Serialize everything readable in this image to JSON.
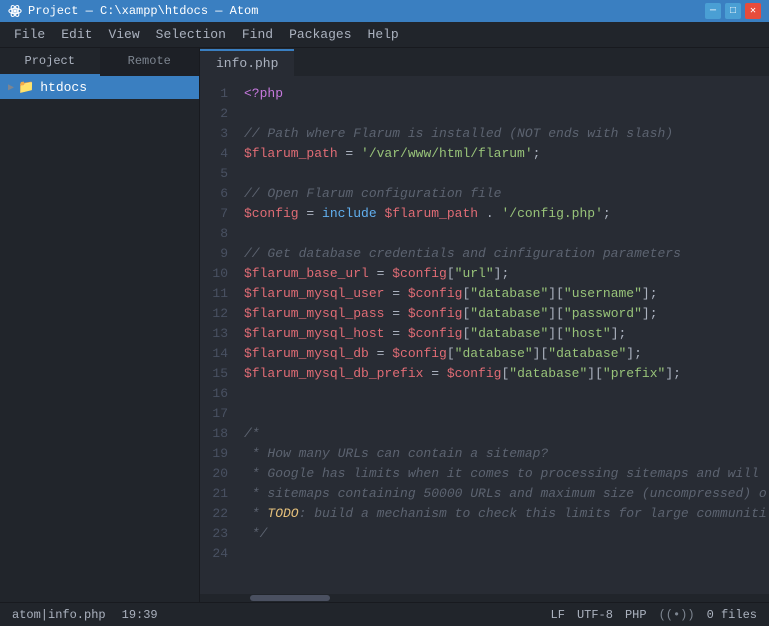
{
  "titleBar": {
    "title": "Project — C:\\xampp\\htdocs — Atom",
    "icon": "atom-icon"
  },
  "menuBar": {
    "items": [
      "File",
      "Edit",
      "View",
      "Selection",
      "Find",
      "Packages",
      "Help"
    ]
  },
  "sidebar": {
    "tabs": [
      {
        "label": "Project",
        "active": true
      },
      {
        "label": "Remote",
        "active": false
      }
    ],
    "tree": [
      {
        "label": "htdocs",
        "type": "folder",
        "expanded": true,
        "selected": true
      }
    ]
  },
  "editor": {
    "tab": "info.php",
    "filename": "info.php"
  },
  "statusBar": {
    "left": {
      "file": "atom|info.php",
      "position": "19:39"
    },
    "right": {
      "encoding_lf": "LF",
      "encoding_utf": "UTF-8",
      "language": "PHP",
      "signal": "(•))",
      "files": "0 files"
    }
  },
  "code": {
    "lines": [
      {
        "num": 1,
        "html": "<span class='kw'>&lt;?php</span>"
      },
      {
        "num": 2,
        "html": ""
      },
      {
        "num": 3,
        "html": "<span class='comment'>// Path where Flarum is installed (NOT ends with slash)</span>"
      },
      {
        "num": 4,
        "html": "<span class='var'>$flarum_path</span><span class='op'> = </span><span class='str'>'/var/www/html/flarum'</span><span class='punct'>;</span>"
      },
      {
        "num": 5,
        "html": ""
      },
      {
        "num": 6,
        "html": "<span class='comment'>// Open Flarum configuration file</span>"
      },
      {
        "num": 7,
        "html": "<span class='var'>$config</span><span class='op'> = </span><span class='fn'>include</span><span class='op'> </span><span class='var'>$flarum_path</span><span class='op'> . </span><span class='str'>'/config.php'</span><span class='punct'>;</span>"
      },
      {
        "num": 8,
        "html": ""
      },
      {
        "num": 9,
        "html": "<span class='comment'>// Get database credentials and cinfiguration parameters</span>"
      },
      {
        "num": 10,
        "html": "<span class='var'>$flarum_base_url</span><span class='op'> = </span><span class='var'>$config</span><span class='punct'>[</span><span class='str'>\"url\"</span><span class='punct'>];</span>"
      },
      {
        "num": 11,
        "html": "<span class='var'>$flarum_mysql_user</span><span class='op'> = </span><span class='var'>$config</span><span class='punct'>[</span><span class='str'>\"database\"</span><span class='punct'>][</span><span class='str'>\"username\"</span><span class='punct'>];</span>"
      },
      {
        "num": 12,
        "html": "<span class='var'>$flarum_mysql_pass</span><span class='op'> = </span><span class='var'>$config</span><span class='punct'>[</span><span class='str'>\"database\"</span><span class='punct'>][</span><span class='str'>\"password\"</span><span class='punct'>];</span>"
      },
      {
        "num": 13,
        "html": "<span class='var'>$flarum_mysql_host</span><span class='op'> = </span><span class='var'>$config</span><span class='punct'>[</span><span class='str'>\"database\"</span><span class='punct'>][</span><span class='str'>\"host\"</span><span class='punct'>];</span>"
      },
      {
        "num": 14,
        "html": "<span class='var'>$flarum_mysql_db</span><span class='op'> = </span><span class='var'>$config</span><span class='punct'>[</span><span class='str'>\"database\"</span><span class='punct'>][</span><span class='str'>\"database\"</span><span class='punct'>];</span>"
      },
      {
        "num": 15,
        "html": "<span class='var'>$flarum_mysql_db_prefix</span><span class='op'> = </span><span class='var'>$config</span><span class='punct'>[</span><span class='str'>\"database\"</span><span class='punct'>][</span><span class='str'>\"prefix\"</span><span class='punct'>];</span>"
      },
      {
        "num": 16,
        "html": ""
      },
      {
        "num": 17,
        "html": ""
      },
      {
        "num": 18,
        "html": "<span class='comment'>/*</span>"
      },
      {
        "num": 19,
        "html": "<span class='comment'> * How many URLs can contain a sitemap?</span>"
      },
      {
        "num": 20,
        "html": "<span class='comment'> * Google has limits when it comes to processing sitemaps and will</span>"
      },
      {
        "num": 21,
        "html": "<span class='comment'> * sitemaps containing 50000 URLs and maximum size (uncompressed) o</span>"
      },
      {
        "num": 22,
        "html": "<span class='comment'> * </span><span class='todo'>TODO</span><span class='comment'>: build a mechanism to check this limits for large communiti</span>"
      },
      {
        "num": 23,
        "html": "<span class='comment'> */</span>"
      },
      {
        "num": 24,
        "html": ""
      }
    ]
  }
}
